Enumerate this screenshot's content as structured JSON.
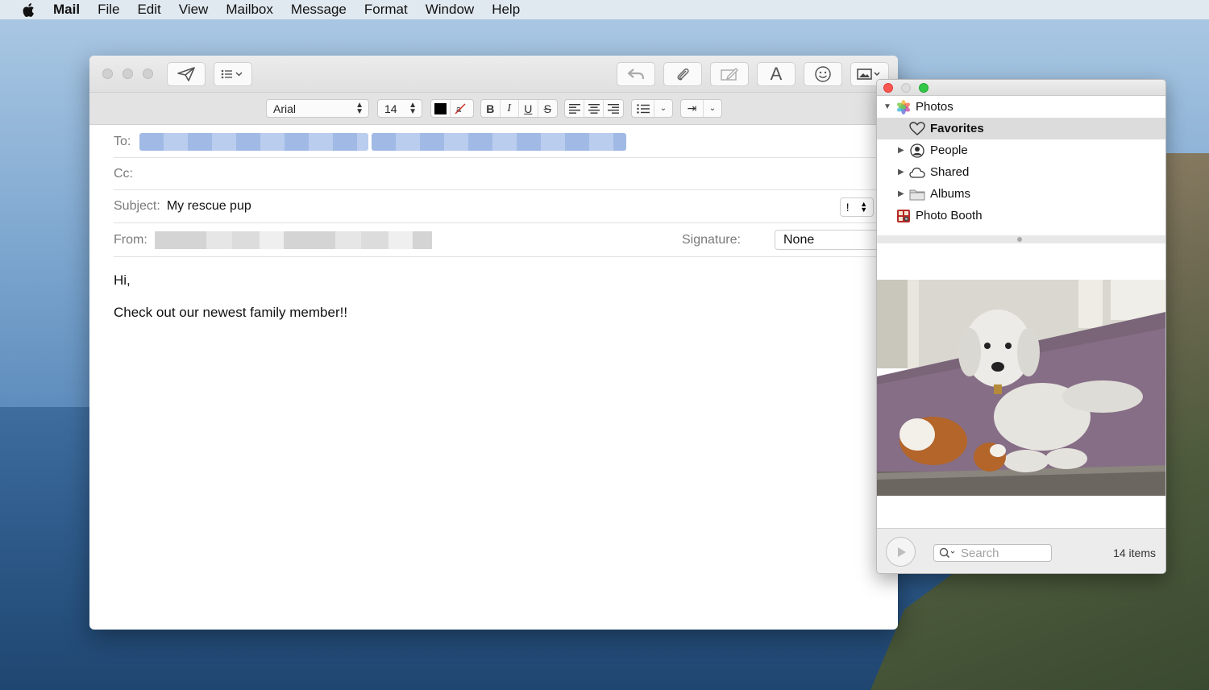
{
  "menubar": {
    "app_name": "Mail",
    "items": [
      "File",
      "Edit",
      "View",
      "Mailbox",
      "Message",
      "Format",
      "Window",
      "Help"
    ]
  },
  "format_bar": {
    "font": "Arial",
    "size": "14",
    "bold": "B",
    "italic": "I",
    "underline": "U",
    "strike": "S"
  },
  "compose": {
    "to_label": "To:",
    "cc_label": "Cc:",
    "subject_label": "Subject:",
    "subject_value": "My rescue pup",
    "priority": "!",
    "from_label": "From:",
    "signature_label": "Signature:",
    "signature_value": "None",
    "body": [
      "Hi,",
      "Check out our newest family member!!"
    ]
  },
  "photo_browser": {
    "sources": [
      {
        "label": "Photos"
      },
      {
        "label": "Favorites"
      },
      {
        "label": "People"
      },
      {
        "label": "Shared"
      },
      {
        "label": "Albums"
      },
      {
        "label": "Photo Booth"
      }
    ],
    "search_placeholder": "Search",
    "item_count": "14 items"
  }
}
